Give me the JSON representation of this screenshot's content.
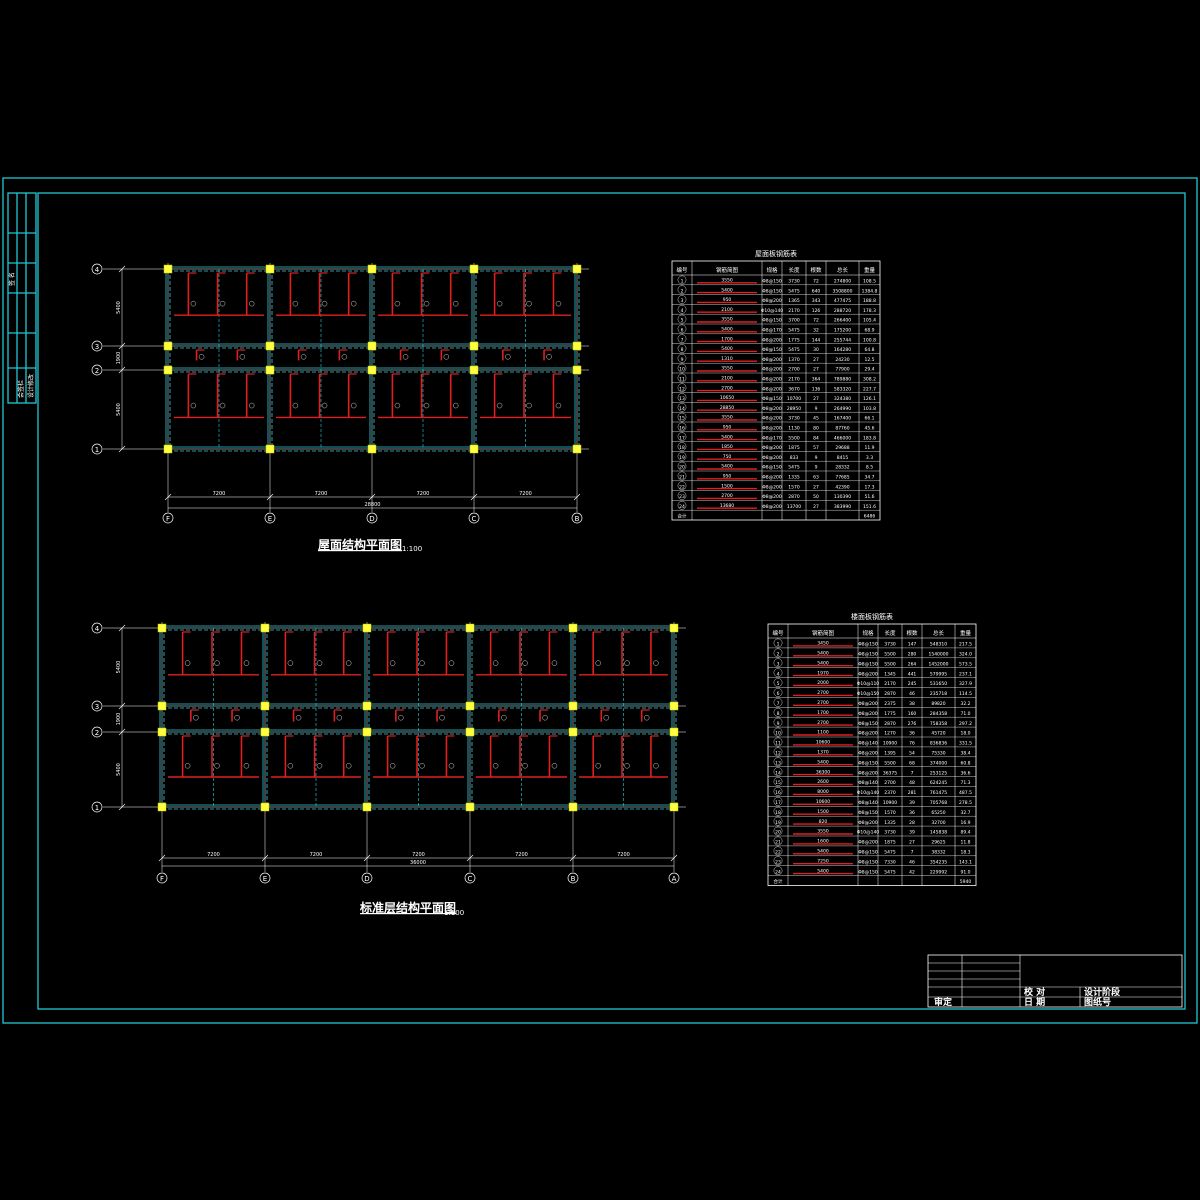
{
  "sheet": {
    "stamp_left": [
      "签 名",
      "会签栏",
      "设计修改"
    ],
    "title_block": {
      "row1": [
        "审定",
        "校 对",
        "设计阶段"
      ],
      "row2": [
        "",
        "日 期",
        "图纸号"
      ]
    }
  },
  "roof_plan": {
    "title": "屋面结构平面图",
    "scale": "1:100",
    "row_axes": [
      "4",
      "3",
      "2",
      "1"
    ],
    "col_axes": [
      "F",
      "E",
      "D",
      "C",
      "B"
    ],
    "left_dims": [
      "5400",
      "1900",
      "5400"
    ],
    "bottom_dims": [
      "7200",
      "7200",
      "7200",
      "7200"
    ],
    "total_dim": "28800"
  },
  "std_plan": {
    "title": "标准层结构平面图",
    "scale": "1:100",
    "row_axes": [
      "4",
      "3",
      "2",
      "1"
    ],
    "col_axes": [
      "F",
      "E",
      "D",
      "C",
      "B",
      "A"
    ],
    "left_dims": [
      "5400",
      "1900",
      "5400"
    ],
    "bottom_dims": [
      "7200",
      "7200",
      "7200",
      "7200",
      "7200"
    ],
    "total_dim": "36000"
  },
  "table1": {
    "title": "屋面板钢筋表",
    "headers": [
      "编号",
      "钢筋简图",
      "规格",
      "长度",
      "根数",
      "总长",
      "重量"
    ],
    "rows": [
      [
        "1",
        "3550",
        "Φ8@150",
        "3730",
        "72",
        "274800",
        "108.5"
      ],
      [
        "2",
        "5400",
        "Φ8@150",
        "5475",
        "640",
        "3508800",
        "1384.8"
      ],
      [
        "3",
        "950",
        "Φ8@200",
        "1365",
        "343",
        "477475",
        "188.8"
      ],
      [
        "4",
        "2100",
        "Φ10@140",
        "2170",
        "126",
        "288720",
        "178.3"
      ],
      [
        "5",
        "3550",
        "Φ8@150",
        "3700",
        "72",
        "266400",
        "105.4"
      ],
      [
        "6",
        "5400",
        "Φ8@170",
        "5475",
        "32",
        "175200",
        "68.9"
      ],
      [
        "7",
        "1700",
        "Φ8@200",
        "1775",
        "144",
        "255744",
        "100.8"
      ],
      [
        "8",
        "5400",
        "Φ8@150",
        "5475",
        "30",
        "164280",
        "64.8"
      ],
      [
        "9",
        "1310",
        "Φ8@200",
        "1370",
        "27",
        "24230",
        "12.5"
      ],
      [
        "10",
        "3550",
        "Φ8@200",
        "2700",
        "27",
        "77900",
        "29.4"
      ],
      [
        "11",
        "2100",
        "Φ8@200",
        "2170",
        "364",
        "789880",
        "308.2"
      ],
      [
        "12",
        "2700",
        "Φ8@200",
        "3670",
        "136",
        "583320",
        "227.7"
      ],
      [
        "13",
        "10650",
        "Φ8@150",
        "10700",
        "27",
        "324380",
        "126.1"
      ],
      [
        "14",
        "28850",
        "Φ8@200",
        "28950",
        "9",
        "264990",
        "103.8"
      ],
      [
        "15",
        "3550",
        "Φ8@200",
        "3730",
        "45",
        "167400",
        "66.1"
      ],
      [
        "16",
        "950",
        "Φ8@200",
        "1130",
        "80",
        "87760",
        "45.6"
      ],
      [
        "17",
        "5400",
        "Φ8@170",
        "5500",
        "84",
        "466000",
        "183.8"
      ],
      [
        "18",
        "1850",
        "Φ8@200",
        "1875",
        "57",
        "29688",
        "11.9"
      ],
      [
        "19",
        "750",
        "Φ8@200",
        "833",
        "9",
        "8415",
        "3.3"
      ],
      [
        "20",
        "5400",
        "Φ8@150",
        "5475",
        "9",
        "28332",
        "8.5"
      ],
      [
        "21",
        "950",
        "Φ8@200",
        "1335",
        "63",
        "77685",
        "34.7"
      ],
      [
        "22",
        "1500",
        "Φ8@200",
        "1570",
        "27",
        "42390",
        "17.3"
      ],
      [
        "23",
        "2700",
        "Φ8@200",
        "2870",
        "50",
        "130390",
        "51.6"
      ],
      [
        "24",
        "13680",
        "Φ8@200",
        "13700",
        "27",
        "383990",
        "151.6"
      ]
    ],
    "total_label": "合计",
    "total": "6486"
  },
  "table2": {
    "title": "楼面板钢筋表",
    "headers": [
      "编号",
      "钢筋简图",
      "规格",
      "长度",
      "根数",
      "总长",
      "重量"
    ],
    "rows": [
      [
        "1",
        "3450",
        "Φ8@150",
        "3730",
        "147",
        "548310",
        "217.5"
      ],
      [
        "2",
        "5400",
        "Φ8@150",
        "5500",
        "280",
        "1540000",
        "324.0"
      ],
      [
        "3",
        "5400",
        "Φ8@150",
        "5500",
        "264",
        "1452000",
        "573.5"
      ],
      [
        "4",
        "1970",
        "Φ8@200",
        "1345",
        "441",
        "579995",
        "237.1"
      ],
      [
        "5",
        "2000",
        "Φ10@110",
        "2170",
        "245",
        "531650",
        "327.9"
      ],
      [
        "6",
        "2700",
        "Φ10@150",
        "2870",
        "46",
        "235718",
        "114.5"
      ],
      [
        "7",
        "2700",
        "Φ8@200",
        "2375",
        "38",
        "89820",
        "32.2"
      ],
      [
        "8",
        "1700",
        "Φ8@200",
        "1775",
        "160",
        "284358",
        "71.0"
      ],
      [
        "9",
        "2700",
        "Φ8@150",
        "2870",
        "276",
        "758358",
        "297.2"
      ],
      [
        "10",
        "1100",
        "Φ8@200",
        "1270",
        "36",
        "45720",
        "18.0"
      ],
      [
        "11",
        "10600",
        "Φ8@140",
        "10900",
        "76",
        "836836",
        "331.5"
      ],
      [
        "12",
        "1370",
        "Φ8@200",
        "1395",
        "54",
        "75330",
        "38.4"
      ],
      [
        "13",
        "5400",
        "Φ8@150",
        "5500",
        "68",
        "374000",
        "60.8"
      ],
      [
        "14",
        "36300",
        "Φ8@200",
        "36375",
        "7",
        "253125",
        "36.6"
      ],
      [
        "15",
        "2600",
        "Φ8@140",
        "2700",
        "48",
        "624245",
        "71.3"
      ],
      [
        "16",
        "8000",
        "Φ10@140",
        "2370",
        "281",
        "761475",
        "487.5"
      ],
      [
        "17",
        "10600",
        "Φ8@140",
        "10900",
        "39",
        "705768",
        "278.5"
      ],
      [
        "18",
        "1500",
        "Φ8@150",
        "1570",
        "36",
        "65250",
        "32.7"
      ],
      [
        "19",
        "820",
        "Φ8@200",
        "1335",
        "28",
        "32700",
        "16.9"
      ],
      [
        "20",
        "3550",
        "Φ10@140",
        "3730",
        "39",
        "145838",
        "89.4"
      ],
      [
        "21",
        "1600",
        "Φ8@200",
        "1875",
        "27",
        "29625",
        "11.8"
      ],
      [
        "22",
        "5400",
        "Φ8@150",
        "5475",
        "7",
        "38332",
        "18.3"
      ],
      [
        "23",
        "7250",
        "Φ8@150",
        "7330",
        "46",
        "354235",
        "143.1"
      ],
      [
        "24",
        "5400",
        "Φ8@150",
        "5475",
        "42",
        "229992",
        "91.0"
      ]
    ],
    "total_label": "合计",
    "total": "5940"
  },
  "colors": {
    "frame": "#1ec8d2",
    "beam": "#2ad0e0",
    "rebar": "#e02020",
    "column": "#ffff40",
    "line": "#ffffff"
  }
}
